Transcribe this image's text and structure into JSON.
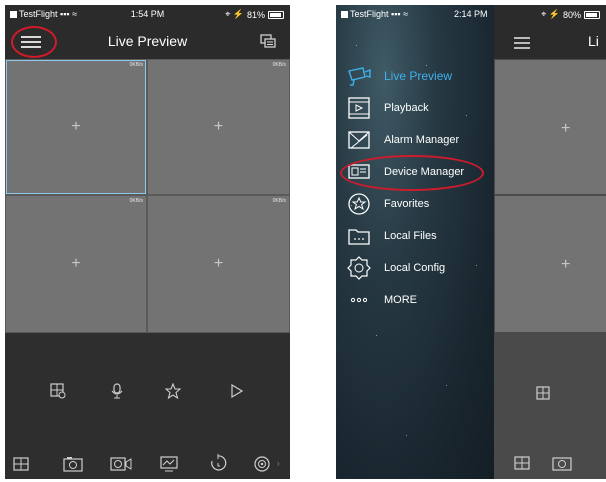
{
  "left_screen": {
    "status": {
      "carrier": "TestFlight",
      "time": "1:54 PM",
      "battery": "81%"
    },
    "title": "Live Preview",
    "channels": [
      {
        "rate": "0KB/s"
      },
      {
        "rate": "0KB/s"
      },
      {
        "rate": "0KB/s"
      },
      {
        "rate": "0KB/s"
      }
    ],
    "plus_symbol": "+",
    "controls": [
      "layout-icon",
      "microphone-icon",
      "star-icon",
      "play-icon"
    ],
    "toolbar": [
      "grid-icon",
      "camera-icon",
      "video-record-icon",
      "monitor-icon",
      "timer-icon",
      "ptz-icon"
    ]
  },
  "right_screen": {
    "status": {
      "carrier": "TestFlight",
      "time": "2:14 PM",
      "battery": "80%"
    },
    "title_partial": "Li",
    "menu": [
      {
        "label": "Live Preview",
        "icon": "live-preview-icon",
        "active": true
      },
      {
        "label": "Playback",
        "icon": "playback-icon",
        "active": false
      },
      {
        "label": "Alarm Manager",
        "icon": "alarm-manager-icon",
        "active": false
      },
      {
        "label": "Device Manager",
        "icon": "device-manager-icon",
        "active": false,
        "highlighted": true
      },
      {
        "label": "Favorites",
        "icon": "favorites-icon",
        "active": false
      },
      {
        "label": "Local Files",
        "icon": "local-files-icon",
        "active": false
      },
      {
        "label": "Local Config",
        "icon": "local-config-icon",
        "active": false
      },
      {
        "label": "MORE",
        "icon": "more-icon",
        "active": false
      }
    ],
    "accent_color": "#3fb1ea",
    "highlight_color": "#cf1b2b"
  }
}
